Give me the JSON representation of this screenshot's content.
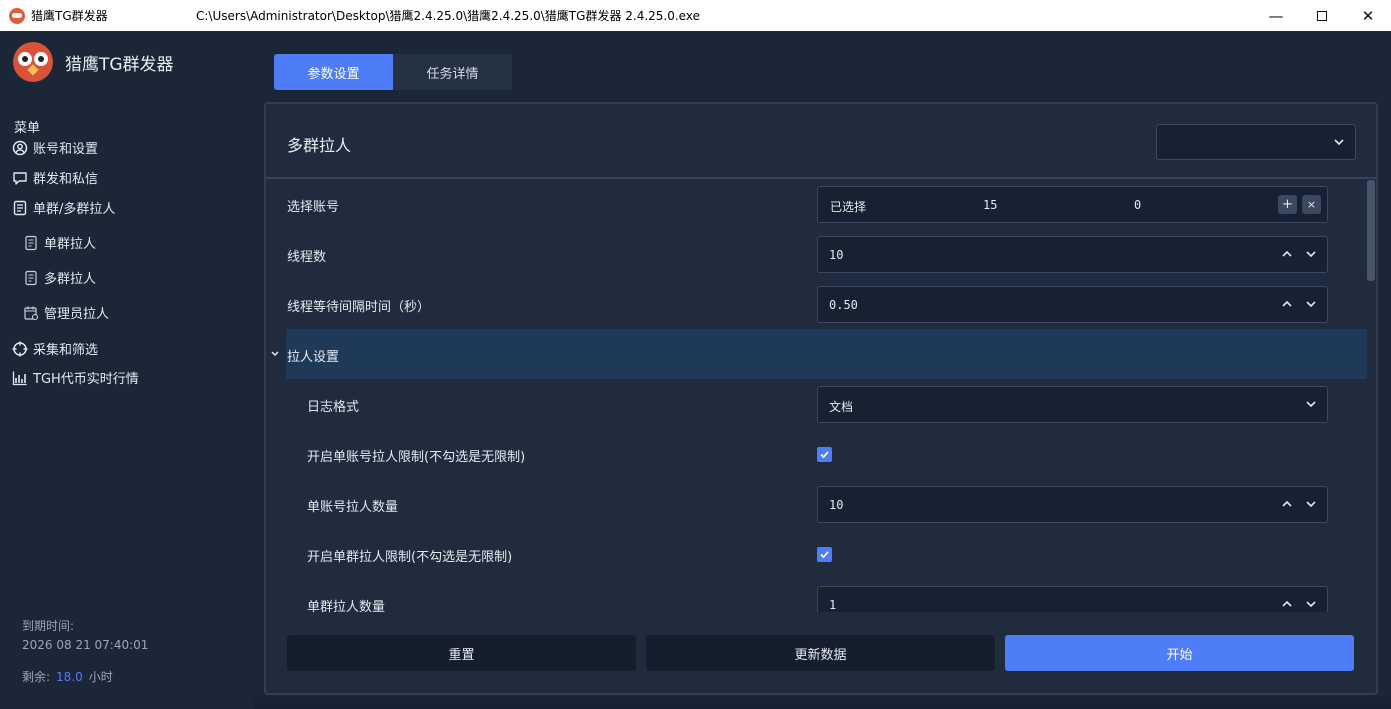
{
  "titlebar": {
    "app_name": "猎鹰TG群发器",
    "path": "C:\\Users\\Administrator\\Desktop\\猎鹰2.4.25.0\\猎鹰2.4.25.0\\猎鹰TG群发器 2.4.25.0.exe",
    "minimize": "—",
    "close": "✕"
  },
  "sidebar": {
    "brand_name": "猎鹰TG群发器",
    "menu_title": "菜单",
    "items": [
      {
        "label": "账号和设置",
        "icon": "user-circle-icon"
      },
      {
        "label": "群发和私信",
        "icon": "chat-bubble-icon"
      },
      {
        "label": "单群/多群拉人",
        "icon": "document-icon"
      },
      {
        "label": "单群拉人",
        "icon": "document-icon"
      },
      {
        "label": "多群拉人",
        "icon": "document-icon"
      },
      {
        "label": "管理员拉人",
        "icon": "calendar-admin-icon"
      },
      {
        "label": "采集和筛选",
        "icon": "crosshair-icon"
      },
      {
        "label": "TGH代币实时行情",
        "icon": "bar-chart-icon"
      }
    ],
    "expiry_label": "到期时间:",
    "expiry_date": "2026 08 21 07:40:01",
    "remaining_label": "剩余:",
    "remaining_value": "18.0",
    "remaining_unit": "小时"
  },
  "tabs": [
    {
      "label": "参数设置",
      "active": true
    },
    {
      "label": "任务详情",
      "active": false
    }
  ],
  "panel": {
    "title": "多群拉人",
    "rows": {
      "account": {
        "label": "选择账号",
        "selected_label": "已选择",
        "n1": "15",
        "n2": "0",
        "plus": "+",
        "clear": "×"
      },
      "threads": {
        "label": "线程数",
        "value": "10"
      },
      "wait": {
        "label": "线程等待间隔时间（秒）",
        "value": "0.50"
      },
      "section": {
        "label": "拉人设置"
      },
      "log_format": {
        "label": "日志格式",
        "value": "文档"
      },
      "account_limit_enable": {
        "label": "开启单账号拉人限制(不勾选是无限制)",
        "checked": true
      },
      "account_limit": {
        "label": "单账号拉人数量",
        "value": "10"
      },
      "group_limit_enable": {
        "label": "开启单群拉人限制(不勾选是无限制)",
        "checked": true
      },
      "group_limit": {
        "label": "单群拉人数量",
        "value": "1"
      }
    }
  },
  "buttons": {
    "reset": "重置",
    "refresh": "更新数据",
    "start": "开始"
  },
  "colors": {
    "accent": "#4f7cf7",
    "background": "#1b2636",
    "panel": "#202c3d",
    "section_highlight": "#1f3a58"
  }
}
